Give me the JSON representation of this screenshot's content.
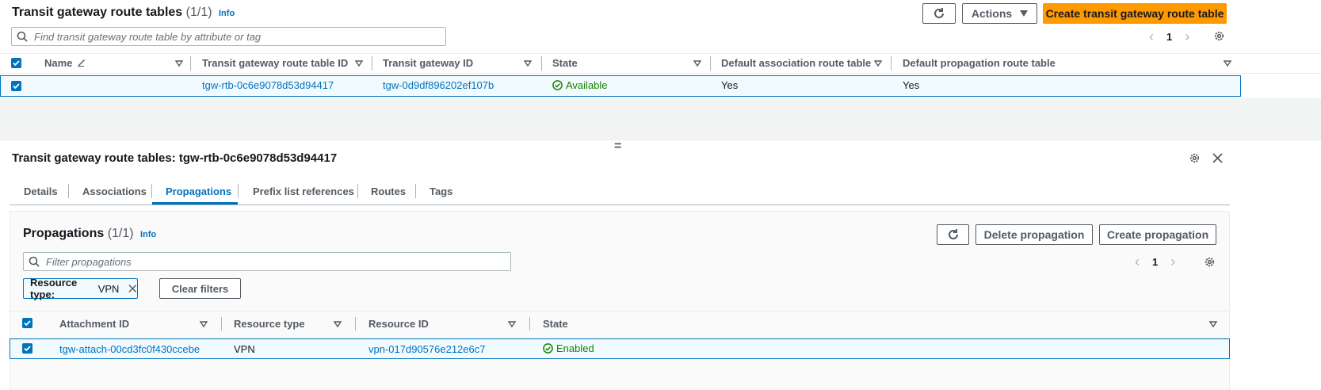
{
  "top": {
    "title": "Transit gateway route tables",
    "count": "(1/1)",
    "info": "Info",
    "actions_label": "Actions",
    "create_label": "Create transit gateway route table",
    "search_placeholder": "Find transit gateway route table by attribute or tag",
    "page": "1",
    "columns": [
      "Name",
      "Transit gateway route table ID",
      "Transit gateway ID",
      "State",
      "Default association route table",
      "Default propagation route table"
    ],
    "row": {
      "name": "",
      "rtb_id": "tgw-rtb-0c6e9078d53d94417",
      "tgw_id": "tgw-0d9df896202ef107b",
      "state": "Available",
      "default_assoc": "Yes",
      "default_prop": "Yes"
    }
  },
  "detail": {
    "title": "Transit gateway route tables: tgw-rtb-0c6e9078d53d94417",
    "tabs": [
      "Details",
      "Associations",
      "Propagations",
      "Prefix list references",
      "Routes",
      "Tags"
    ],
    "active_tab": "Propagations"
  },
  "propagations": {
    "title": "Propagations",
    "count": "(1/1)",
    "info": "Info",
    "delete_label": "Delete propagation",
    "create_label": "Create propagation",
    "search_placeholder": "Filter propagations",
    "filter_token_key": "Resource type:",
    "filter_token_value": "VPN",
    "clear_filters": "Clear filters",
    "page": "1",
    "columns": [
      "Attachment ID",
      "Resource type",
      "Resource ID",
      "State"
    ],
    "row": {
      "attachment_id": "tgw-attach-00cd3fc0f430ccebe",
      "resource_type": "VPN",
      "resource_id": "vpn-017d90576e212e6c7",
      "state": "Enabled"
    }
  },
  "colors": {
    "link": "#0073bb",
    "primary": "#ff9900",
    "success": "#1d8102"
  },
  "splitter_glyph": "="
}
